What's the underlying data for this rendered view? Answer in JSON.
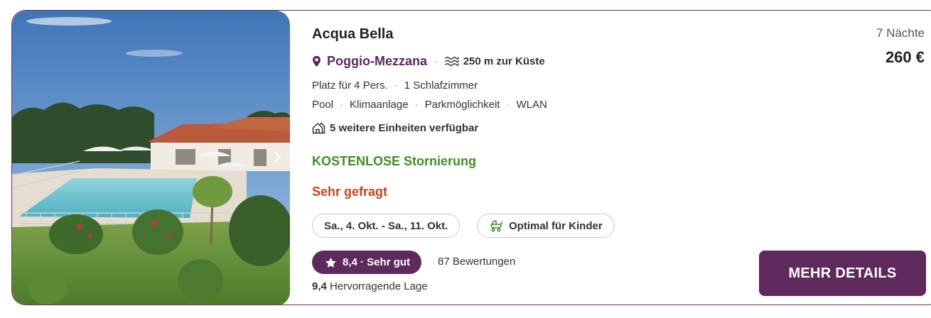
{
  "listing": {
    "title": "Acqua Bella",
    "location": "Poggio-Mezzana",
    "coast_distance": "250 m zur Küste",
    "capacity": "Platz für 4 Pers.",
    "bedrooms": "1 Schlafzimmer",
    "amenities": [
      "Pool",
      "Klimaanlage",
      "Parkmöglichkeit",
      "WLAN"
    ],
    "more_units": "5 weitere Einheiten verfügbar",
    "free_cancellation": "KOSTENLOSE Stornierung",
    "popularity": "Sehr gefragt",
    "dates": "Sa., 4. Okt. - Sa., 11. Okt.",
    "kids_tag": "Optimal für Kinder",
    "rating_badge": "8,4 · Sehr gut",
    "reviews": "87 Bewertungen",
    "location_score_value": "9,4",
    "location_score_label": "Hervorragende Lage",
    "nights": "7 Nächte",
    "price": "260 €",
    "cta": "MEHR DETAILS"
  },
  "colors": {
    "brand_purple": "#5e2a5c",
    "location_purple": "#5b2a5d",
    "free_green": "#3f8f26",
    "popular_red": "#c24520"
  },
  "icons": {
    "location": "map-pin-icon",
    "coast": "waves-icon",
    "units": "house-icon",
    "kids": "baby-stroller-icon",
    "rating": "star-icon",
    "photo_next": "chevron-right-icon"
  }
}
